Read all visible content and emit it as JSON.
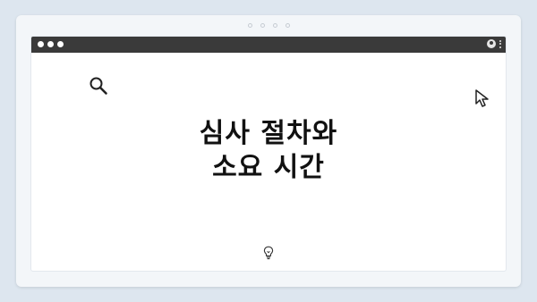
{
  "window": {
    "title_lines": [
      "심사 절차와",
      "소요 시간"
    ]
  },
  "icons": {
    "search": "search-icon",
    "cursor": "cursor-icon",
    "bulb": "lightbulb-icon",
    "user": "user-icon",
    "menu": "kebab-menu-icon"
  },
  "colors": {
    "background": "#dde6ef",
    "titlebar": "#3a3a3a",
    "text": "#111111"
  }
}
